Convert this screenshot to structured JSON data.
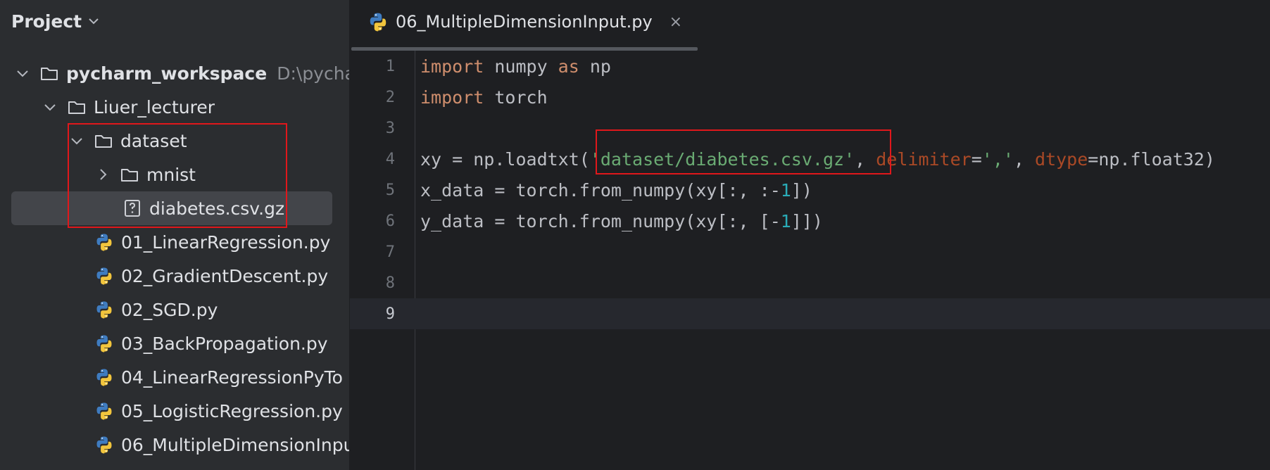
{
  "project": {
    "title": "Project",
    "tree": [
      {
        "label": "pycharm_workspace",
        "path": "D:\\pycharm",
        "type": "folder",
        "expanded": true
      },
      {
        "label": "Liuer_lecturer",
        "type": "folder",
        "expanded": true
      },
      {
        "label": "dataset",
        "type": "folder",
        "expanded": true
      },
      {
        "label": "mnist",
        "type": "folder",
        "expanded": false
      },
      {
        "label": "diabetes.csv.gz",
        "type": "unknown-file",
        "selected": true
      },
      {
        "label": "01_LinearRegression.py",
        "type": "python"
      },
      {
        "label": "02_GradientDescent.py",
        "type": "python"
      },
      {
        "label": "02_SGD.py",
        "type": "python"
      },
      {
        "label": "03_BackPropagation.py",
        "type": "python"
      },
      {
        "label": "04_LinearRegressionPyTo",
        "type": "python"
      },
      {
        "label": "05_LogisticRegression.py",
        "type": "python"
      },
      {
        "label": "06_MultipleDimensionInpu",
        "type": "python"
      }
    ]
  },
  "editor": {
    "tab_label": "06_MultipleDimensionInput.py",
    "tab_close": "×",
    "line_numbers": [
      "1",
      "2",
      "3",
      "4",
      "5",
      "6",
      "7",
      "8",
      "9"
    ],
    "current_line": "9",
    "code": {
      "l1": {
        "kw1": "import",
        "t1": " numpy ",
        "kw2": "as",
        "t2": " np"
      },
      "l2": {
        "kw1": "import",
        "t1": " torch"
      },
      "l4": {
        "t1": "xy = np.loadtxt(",
        "str1": "'dataset/diabetes.csv.gz'",
        "t2": ", ",
        "p1": "delimiter",
        "t3": "=",
        "str2": "','",
        "t4": ", ",
        "p2": "dtype",
        "t5": "=np.float32)"
      },
      "l5": {
        "t1": "x_data = torch.from_numpy(xy[:, :-",
        "n1": "1",
        "t2": "])"
      },
      "l6": {
        "t1": "y_data = torch.from_numpy(xy[:, [-",
        "n1": "1",
        "t2": "]])"
      }
    }
  },
  "colors": {
    "keyword": "#cf8e6d",
    "string": "#6aab73",
    "number": "#2aacb8",
    "param": "#aa4926",
    "highlight_box": "#e0171b"
  }
}
